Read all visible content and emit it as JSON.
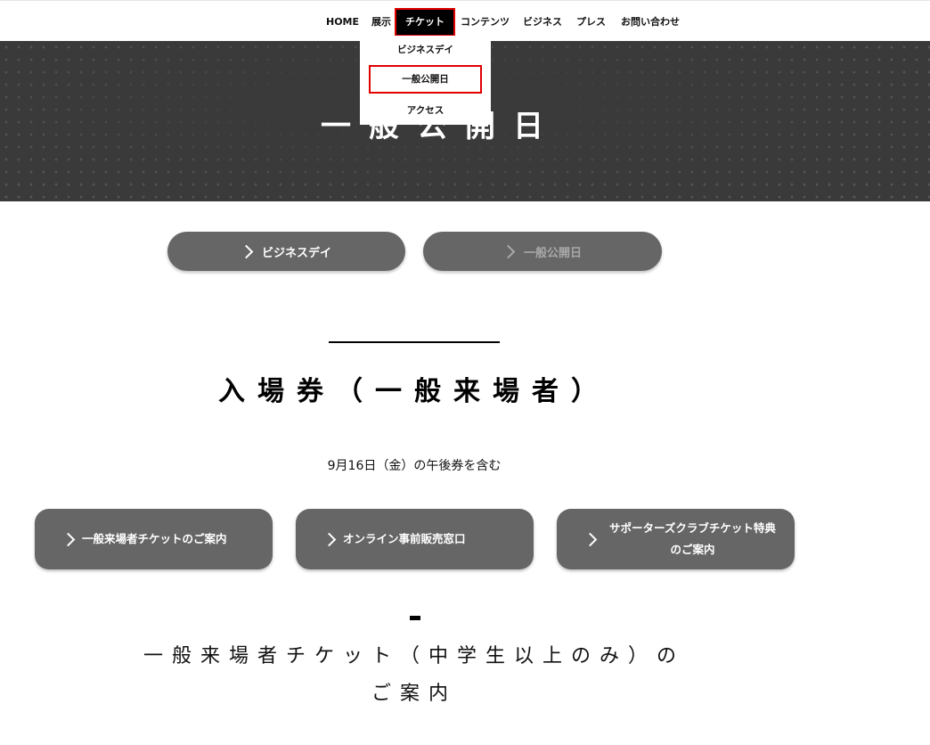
{
  "nav": {
    "items": [
      {
        "label": "HOME"
      },
      {
        "label": "展示"
      },
      {
        "label": "チケット"
      },
      {
        "label": "コンテンツ"
      },
      {
        "label": "ビジネス"
      },
      {
        "label": "プレス"
      },
      {
        "label": "お問い合わせ"
      }
    ],
    "active_index": 2,
    "dropdown": [
      {
        "label": "ビジネスデイ"
      },
      {
        "label": "一般公開日"
      },
      {
        "label": "アクセス"
      }
    ]
  },
  "hero": {
    "title": "一般公開日"
  },
  "tabs": [
    {
      "label": "ビジネスデイ",
      "state": "enabled"
    },
    {
      "label": "一般公開日",
      "state": "current"
    }
  ],
  "section": {
    "title": "入場券（一般来場者）",
    "note": "9月16日（金）の午後券を含む"
  },
  "cards": [
    {
      "line1": "一般来場者チケットのご案内",
      "line2": ""
    },
    {
      "line1": "オンライン事前販売窓口",
      "line2": ""
    },
    {
      "line1": "サポーターズクラブチケット特典",
      "line2": "のご案内"
    }
  ],
  "subsection": {
    "line1": "一般来場者チケット（中学生以上のみ）の",
    "line2": "ご案内"
  },
  "colors": {
    "accent_highlight": "#e00000",
    "button_bg": "#666666",
    "hero_bg": "#3a3a3a"
  },
  "icons": {
    "chevron": "chevron-right-icon"
  }
}
